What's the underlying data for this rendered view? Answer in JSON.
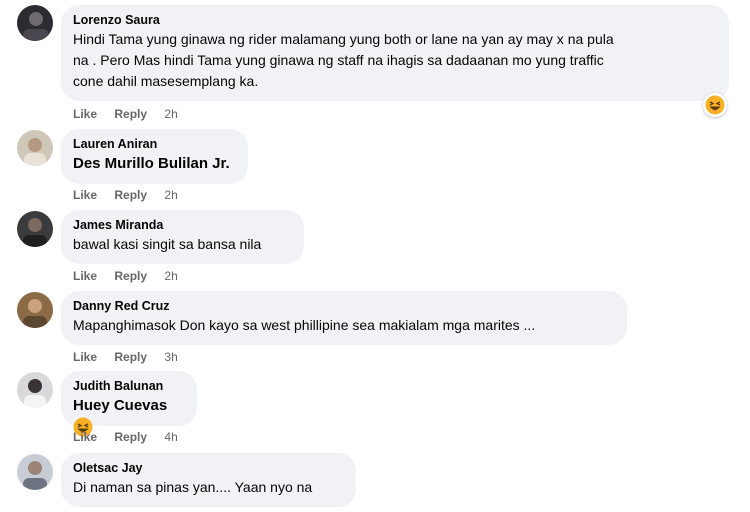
{
  "actions": {
    "like_label": "Like",
    "reply_label": "Reply"
  },
  "comments": [
    {
      "author": "Lorenzo Saura",
      "text_lines": [
        "Hindi Tama yung ginawa ng rider malamang yung both or lane na yan ay may x na pula",
        "na . Pero Mas hindi Tama yung ginawa ng staff na ihagis sa dadaanan mo yung traffic",
        "cone dahil masesemplang ka."
      ],
      "time": "2h",
      "reaction_icon": "haha-emoji-icon"
    },
    {
      "author": "Lauren Aniran",
      "text": "Des Murillo Bulilan Jr.",
      "time": "2h"
    },
    {
      "author": "James Miranda",
      "text": "bawal kasi singit sa bansa nila",
      "time": "2h"
    },
    {
      "author": "Danny Red Cruz",
      "text": "Mapanghimasok Don kayo sa west phillipine sea makialam mga marites ...",
      "time": "3h"
    },
    {
      "author": "Judith Balunan",
      "text": "Huey Cuevas",
      "time": "4h",
      "inline_emoji": "haha-emoji-icon"
    },
    {
      "author": "Oletsac Jay",
      "text": "Di naman sa pinas yan.... Yaan nyo na"
    }
  ],
  "colors": {
    "bubble_bg": "#f0f2f5",
    "meta_text": "#65676b",
    "body_text": "#050505",
    "emoji_yellow": "#f7b125"
  }
}
